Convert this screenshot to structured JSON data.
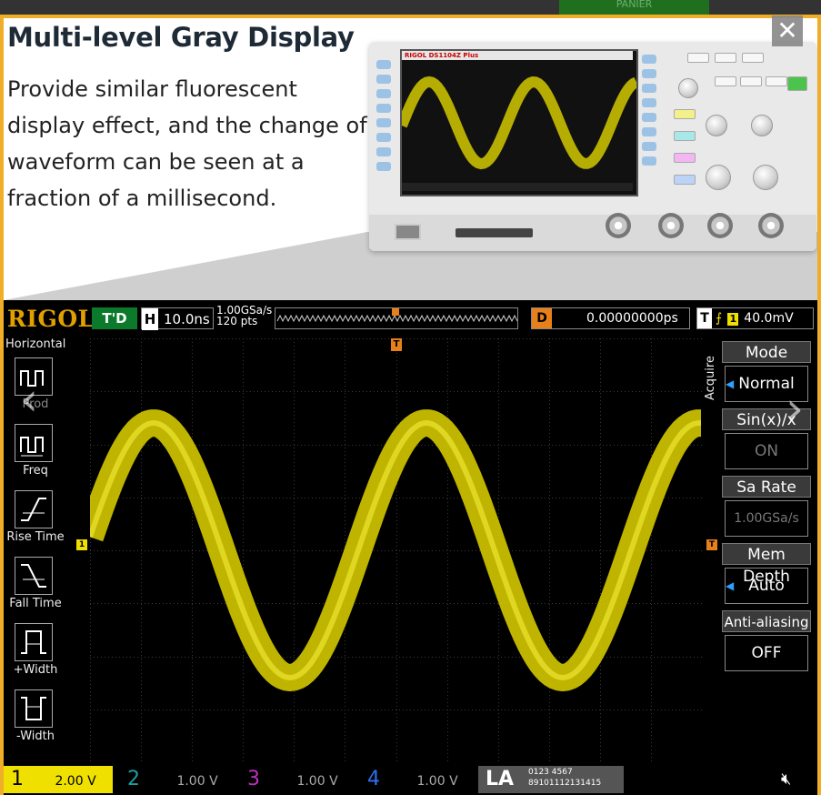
{
  "topbar": {
    "green_text": "PANIER"
  },
  "close_symbol": "✕",
  "heading": "Multi-level Gray Display",
  "description": "Provide similar fluorescent display effect, and the change of waveform can be seen at a fraction of a millisecond.",
  "device": {
    "brand": "RIGOL DS1104Z Plus"
  },
  "scope": {
    "brand": "RIGOL",
    "run_state": "T'D",
    "timebase_prefix": "H",
    "timebase": "10.0ns",
    "sample_rate": "1.00GSa/s",
    "points": "120 pts",
    "delay_prefix": "D",
    "delay": "0.00000000ps",
    "trigger_prefix": "T",
    "trigger_channel": "1",
    "trigger_level": "40.0mV",
    "trigger_marker": "T",
    "level_marker_left": "1",
    "level_marker_right": "T"
  },
  "left_menu": {
    "title": "Horizontal",
    "items": [
      {
        "label": "Period"
      },
      {
        "label": "Freq"
      },
      {
        "label": "Rise Time"
      },
      {
        "label": "Fall Time"
      },
      {
        "label": "+Width"
      },
      {
        "label": "-Width"
      }
    ],
    "period_partial": "Prod"
  },
  "right_menu": {
    "section": "Acquire",
    "items": [
      {
        "label": "Mode",
        "value": "Normal",
        "dim": false,
        "arrow": true
      },
      {
        "label": "Sin(x)/x",
        "value": "ON",
        "dim": true,
        "arrow": false
      },
      {
        "label": "Sa Rate",
        "value": "1.00GSa/s",
        "dim": true,
        "arrow": false
      },
      {
        "label": "Mem Depth",
        "value": "Auto",
        "dim": false,
        "arrow": true
      },
      {
        "label": "Anti-aliasing",
        "value": "OFF",
        "dim": false,
        "arrow": false
      }
    ]
  },
  "channels": [
    {
      "num": "1",
      "scale": "2.00 V",
      "color": "#f0e000"
    },
    {
      "num": "2",
      "scale": "1.00 V",
      "color": "#1aa0a0"
    },
    {
      "num": "3",
      "scale": "1.00 V",
      "color": "#c02ec0"
    },
    {
      "num": "4",
      "scale": "1.00 V",
      "color": "#2e6ff0"
    }
  ],
  "la": {
    "label": "LA",
    "bits_top": "0123 4567",
    "bits_bottom": "89101112131415"
  },
  "colors": {
    "waveform": "#e0d400",
    "frame": "#f0ad28",
    "trigger": "#e7801b"
  },
  "nav": {
    "prev": "‹",
    "next": "›"
  }
}
